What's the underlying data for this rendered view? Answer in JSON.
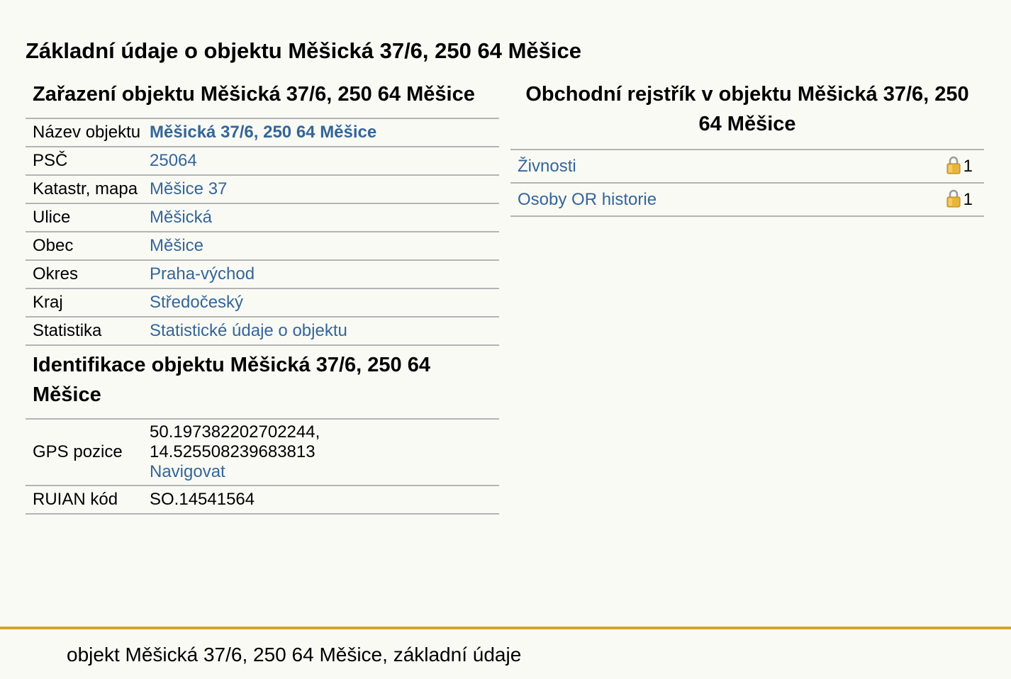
{
  "page": {
    "title": "Základní údaje o objektu Měšická 37/6, 250 64 Měšice",
    "footer": "objekt Měšická 37/6, 250 64 Měšice, základní údaje"
  },
  "classification": {
    "title": "Zařazení objektu Měšická 37/6, 250 64 Měšice",
    "rows": [
      {
        "label": "Název objektu",
        "value": "Měšická 37/6, 250 64 Měšice"
      },
      {
        "label": "PSČ",
        "value": "25064"
      },
      {
        "label": "Katastr, mapa",
        "value": "Měšice 37"
      },
      {
        "label": "Ulice",
        "value": "Měšická"
      },
      {
        "label": "Obec",
        "value": "Měšice"
      },
      {
        "label": "Okres",
        "value": "Praha-východ"
      },
      {
        "label": "Kraj",
        "value": "Středočeský"
      },
      {
        "label": "Statistika",
        "value": "Statistické údaje o objektu"
      }
    ]
  },
  "identification": {
    "title": "Identifikace objektu Měšická 37/6, 250 64 Měšice",
    "gps_label": "GPS pozice",
    "gps_lat": "50.197382202702244,",
    "gps_lon": "14.525508239683813",
    "navigate": "Navigovat",
    "ruian_label": "RUIAN kód",
    "ruian_value": "SO.14541564"
  },
  "register": {
    "title": "Obchodní rejstřík v objektu Měšická 37/6, 250 64 Měšice",
    "rows": [
      {
        "label": "Živnosti",
        "count": "1"
      },
      {
        "label": "Osoby OR historie",
        "count": "1"
      }
    ]
  },
  "colors": {
    "link": "#336699",
    "footer_accent": "#d6a324",
    "lock": "#e8b53a"
  },
  "icons": {
    "lock": "lock-icon"
  }
}
